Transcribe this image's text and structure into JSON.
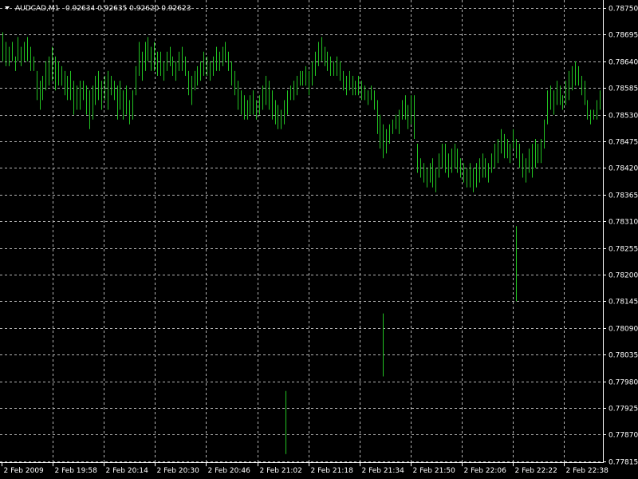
{
  "chart_data": {
    "type": "bar",
    "symbol": "AUDCAD,M1",
    "quote": "0.92634 0.92635 0.92620 0.92623",
    "x_tick_labels": [
      "2 Feb 2009",
      "2 Feb 19:58",
      "2 Feb 20:14",
      "2 Feb 20:30",
      "2 Feb 20:46",
      "2 Feb 21:02",
      "2 Feb 21:18",
      "2 Feb 21:34",
      "2 Feb 21:50",
      "2 Feb 22:06",
      "2 Feb 22:22",
      "2 Feb 22:38"
    ],
    "y_tick_labels": [
      "0.78750",
      "0.78695",
      "0.78640",
      "0.78585",
      "0.78530",
      "0.78475",
      "0.78420",
      "0.78365",
      "0.78310",
      "0.78255",
      "0.78200",
      "0.78145",
      "0.78090",
      "0.78035",
      "0.77980",
      "0.77925",
      "0.77870",
      "0.77815"
    ],
    "ylim": [
      0.77815,
      0.7875
    ],
    "grid": true,
    "colors": {
      "background": "#000000",
      "grid": "#b4b4b4",
      "bars": "#22c322",
      "text": "#ffffff",
      "axis": "#ffffff"
    },
    "series": [
      {
        "values": [
          [
            0.787,
            0.7864
          ],
          [
            0.7868,
            0.7863
          ],
          [
            0.7867,
            0.7863
          ],
          [
            0.7868,
            0.7864
          ],
          [
            0.7865,
            0.7862
          ],
          [
            0.7869,
            0.7864
          ],
          [
            0.7867,
            0.7863
          ],
          [
            0.7868,
            0.7864
          ],
          [
            0.7869,
            0.7864
          ],
          [
            0.7867,
            0.7862
          ],
          [
            0.7865,
            0.7862
          ],
          [
            0.7862,
            0.7856
          ],
          [
            0.786,
            0.7854
          ],
          [
            0.7861,
            0.7856
          ],
          [
            0.7864,
            0.7858
          ],
          [
            0.7865,
            0.7859
          ],
          [
            0.7867,
            0.786
          ],
          [
            0.7865,
            0.7858
          ],
          [
            0.7864,
            0.7859
          ],
          [
            0.7863,
            0.7859
          ],
          [
            0.7862,
            0.7857
          ],
          [
            0.7861,
            0.7856
          ],
          [
            0.7862,
            0.7856
          ],
          [
            0.786,
            0.7853
          ],
          [
            0.7859,
            0.7854
          ],
          [
            0.786,
            0.7854
          ],
          [
            0.786,
            0.7856
          ],
          [
            0.7859,
            0.7853
          ],
          [
            0.7858,
            0.785
          ],
          [
            0.7859,
            0.7852
          ],
          [
            0.7861,
            0.7855
          ],
          [
            0.7862,
            0.7856
          ],
          [
            0.786,
            0.7854
          ],
          [
            0.7861,
            0.7856
          ],
          [
            0.7862,
            0.7854
          ],
          [
            0.7861,
            0.7857
          ],
          [
            0.786,
            0.7856
          ],
          [
            0.7859,
            0.7852
          ],
          [
            0.786,
            0.7854
          ],
          [
            0.7858,
            0.7852
          ],
          [
            0.7859,
            0.7853
          ],
          [
            0.7856,
            0.7851
          ],
          [
            0.7858,
            0.7852
          ],
          [
            0.7863,
            0.7857
          ],
          [
            0.7868,
            0.7861
          ],
          [
            0.7866,
            0.786
          ],
          [
            0.7868,
            0.7862
          ],
          [
            0.7869,
            0.7864
          ],
          [
            0.7867,
            0.7862
          ],
          [
            0.7868,
            0.7862
          ],
          [
            0.7866,
            0.7861
          ],
          [
            0.7866,
            0.7861
          ],
          [
            0.7864,
            0.786
          ],
          [
            0.7866,
            0.7862
          ],
          [
            0.7867,
            0.7863
          ],
          [
            0.7865,
            0.7861
          ],
          [
            0.7864,
            0.786
          ],
          [
            0.7866,
            0.7862
          ],
          [
            0.7867,
            0.7862
          ],
          [
            0.7865,
            0.7861
          ],
          [
            0.7862,
            0.7857
          ],
          [
            0.7861,
            0.7855
          ],
          [
            0.7862,
            0.7858
          ],
          [
            0.7863,
            0.7859
          ],
          [
            0.7864,
            0.786
          ],
          [
            0.7866,
            0.7861
          ],
          [
            0.7865,
            0.7861
          ],
          [
            0.7864,
            0.786
          ],
          [
            0.7865,
            0.7861
          ],
          [
            0.7867,
            0.7862
          ],
          [
            0.7866,
            0.7862
          ],
          [
            0.7867,
            0.7863
          ],
          [
            0.7868,
            0.7864
          ],
          [
            0.7866,
            0.7862
          ],
          [
            0.7864,
            0.7859
          ],
          [
            0.7862,
            0.7857
          ],
          [
            0.786,
            0.7854
          ],
          [
            0.7858,
            0.7853
          ],
          [
            0.7857,
            0.7852
          ],
          [
            0.7856,
            0.7852
          ],
          [
            0.7857,
            0.7853
          ],
          [
            0.7858,
            0.7853
          ],
          [
            0.7856,
            0.7852
          ],
          [
            0.7857,
            0.7853
          ],
          [
            0.7859,
            0.7854
          ],
          [
            0.7861,
            0.7855
          ],
          [
            0.786,
            0.7854
          ],
          [
            0.7858,
            0.7852
          ],
          [
            0.7856,
            0.7851
          ],
          [
            0.7855,
            0.785
          ],
          [
            0.7854,
            0.785
          ],
          [
            0.7856,
            0.7851
          ],
          [
            0.7858,
            0.7853
          ],
          [
            0.7859,
            0.7856
          ],
          [
            0.786,
            0.7856
          ],
          [
            0.7861,
            0.7857
          ],
          [
            0.7862,
            0.7859
          ],
          [
            0.7862,
            0.7859
          ],
          [
            0.7863,
            0.7859
          ],
          [
            0.7862,
            0.7857
          ],
          [
            0.7864,
            0.7859
          ],
          [
            0.7866,
            0.7861
          ],
          [
            0.7868,
            0.7863
          ],
          [
            0.7869,
            0.7864
          ],
          [
            0.7867,
            0.7863
          ],
          [
            0.7866,
            0.7862
          ],
          [
            0.7865,
            0.7861
          ],
          [
            0.7864,
            0.7861
          ],
          [
            0.7865,
            0.7861
          ],
          [
            0.7864,
            0.786
          ],
          [
            0.7862,
            0.7858
          ],
          [
            0.7861,
            0.7857
          ],
          [
            0.7862,
            0.7858
          ],
          [
            0.7861,
            0.7857
          ],
          [
            0.786,
            0.7857
          ],
          [
            0.7861,
            0.7857
          ],
          [
            0.786,
            0.7856
          ],
          [
            0.7859,
            0.7856
          ],
          [
            0.7858,
            0.7855
          ],
          [
            0.7859,
            0.7856
          ],
          [
            0.7858,
            0.7854
          ],
          [
            0.7856,
            0.7849
          ],
          [
            0.7853,
            0.7846
          ],
          [
            0.7851,
            0.7844
          ],
          [
            0.785,
            0.7845
          ],
          [
            0.7851,
            0.7847
          ],
          [
            0.7852,
            0.7849
          ],
          [
            0.7853,
            0.785
          ],
          [
            0.7854,
            0.7849
          ],
          [
            0.7856,
            0.7852
          ],
          [
            0.7857,
            0.7852
          ],
          [
            0.7855,
            0.785
          ],
          [
            0.7857,
            0.7851
          ],
          [
            0.7857,
            0.7848
          ],
          [
            0.7847,
            0.7841
          ],
          [
            0.7844,
            0.784
          ],
          [
            0.7843,
            0.7839
          ],
          [
            0.7842,
            0.7838
          ],
          [
            0.7843,
            0.7839
          ],
          [
            0.7844,
            0.7838
          ],
          [
            0.7842,
            0.7837
          ],
          [
            0.7845,
            0.784
          ],
          [
            0.7847,
            0.7842
          ],
          [
            0.7847,
            0.7841
          ],
          [
            0.7845,
            0.784
          ],
          [
            0.7846,
            0.7841
          ],
          [
            0.7847,
            0.7842
          ],
          [
            0.7846,
            0.7841
          ],
          [
            0.7844,
            0.784
          ],
          [
            0.7843,
            0.7839
          ],
          [
            0.7842,
            0.7838
          ],
          [
            0.7843,
            0.7838
          ],
          [
            0.7842,
            0.7837
          ],
          [
            0.7843,
            0.7838
          ],
          [
            0.7844,
            0.7839
          ],
          [
            0.7845,
            0.784
          ],
          [
            0.7844,
            0.784
          ],
          [
            0.7843,
            0.7839
          ],
          [
            0.7845,
            0.7841
          ],
          [
            0.7847,
            0.7842
          ],
          [
            0.7848,
            0.7843
          ],
          [
            0.785,
            0.7845
          ],
          [
            0.7849,
            0.7844
          ],
          [
            0.7848,
            0.7844
          ],
          [
            0.7847,
            0.7843
          ],
          [
            0.785,
            0.7846
          ],
          [
            0.7848,
            0.7844
          ],
          [
            0.7847,
            0.7842
          ],
          [
            0.7845,
            0.784
          ],
          [
            0.7844,
            0.7839
          ],
          [
            0.7846,
            0.7841
          ],
          [
            0.7847,
            0.784
          ],
          [
            0.7848,
            0.7842
          ],
          [
            0.7847,
            0.7843
          ],
          [
            0.7848,
            0.7843
          ],
          [
            0.7852,
            0.7846
          ],
          [
            0.7858,
            0.7851
          ],
          [
            0.7859,
            0.7854
          ],
          [
            0.7858,
            0.7853
          ],
          [
            0.786,
            0.7855
          ],
          [
            0.7859,
            0.7855
          ],
          [
            0.7857,
            0.7854
          ],
          [
            0.786,
            0.7855
          ],
          [
            0.7862,
            0.7856
          ],
          [
            0.7863,
            0.7858
          ],
          [
            0.7864,
            0.7859
          ],
          [
            0.7863,
            0.7859
          ],
          [
            0.7861,
            0.7857
          ],
          [
            0.786,
            0.7855
          ],
          [
            0.7856,
            0.7852
          ],
          [
            0.7854,
            0.7851
          ],
          [
            0.7854,
            0.7852
          ],
          [
            0.7856,
            0.7852
          ],
          [
            0.7858,
            0.7854
          ]
        ],
        "spikes": [
          [
            0.7796,
            0.7783
          ],
          [
            0.7812,
            0.7799
          ],
          [
            0.783,
            0.78145
          ]
        ]
      }
    ]
  }
}
